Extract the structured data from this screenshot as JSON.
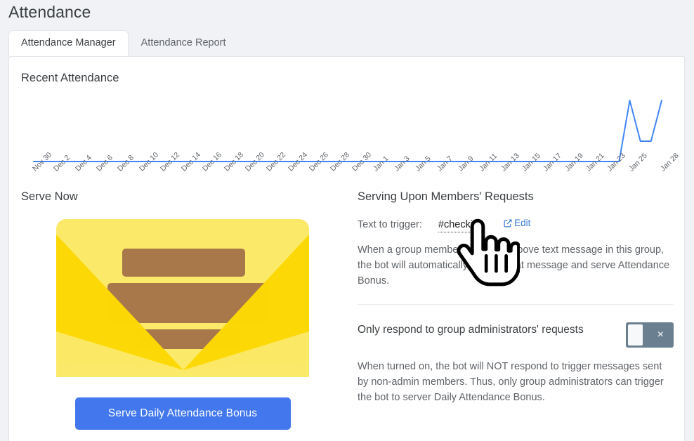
{
  "page": {
    "title": "Attendance",
    "background_color": "#f1f2f6",
    "card_color": "#ffffff"
  },
  "tabs": [
    {
      "label": "Attendance Manager",
      "active": true
    },
    {
      "label": "Attendance Report",
      "active": false
    }
  ],
  "chart_section": {
    "title": "Recent Attendance"
  },
  "chart_data": {
    "type": "line",
    "title": "Recent Attendance",
    "xlabel": "",
    "ylabel": "",
    "grid": false,
    "legend": "none",
    "line_color": "#4285f4",
    "ylim": [
      0,
      3
    ],
    "categories": [
      "Nov 30",
      "Dec 2",
      "Dec 4",
      "Dec 6",
      "Dec 8",
      "Dec 10",
      "Dec 12",
      "Dec 14",
      "Dec 16",
      "Dec 18",
      "Dec 20",
      "Dec 22",
      "Dec 24",
      "Dec 26",
      "Dec 28",
      "Dec 30",
      "Jan 1",
      "Jan 3",
      "Jan 5",
      "Jan 7",
      "Jan 9",
      "Jan 11",
      "Jan 13",
      "Jan 15",
      "Jan 17",
      "Jan 19",
      "Jan 21",
      "Jan 23",
      "Jan 25",
      "Jan 28"
    ],
    "x": [
      "Nov 30",
      "Dec 1",
      "Dec 2",
      "Dec 3",
      "Dec 4",
      "Dec 5",
      "Dec 6",
      "Dec 7",
      "Dec 8",
      "Dec 9",
      "Dec 10",
      "Dec 11",
      "Dec 12",
      "Dec 13",
      "Dec 14",
      "Dec 15",
      "Dec 16",
      "Dec 17",
      "Dec 18",
      "Dec 19",
      "Dec 20",
      "Dec 21",
      "Dec 22",
      "Dec 23",
      "Dec 24",
      "Dec 25",
      "Dec 26",
      "Dec 27",
      "Dec 28",
      "Dec 29",
      "Dec 30",
      "Dec 31",
      "Jan 1",
      "Jan 2",
      "Jan 3",
      "Jan 4",
      "Jan 5",
      "Jan 6",
      "Jan 7",
      "Jan 8",
      "Jan 9",
      "Jan 10",
      "Jan 11",
      "Jan 12",
      "Jan 13",
      "Jan 14",
      "Jan 15",
      "Jan 16",
      "Jan 17",
      "Jan 18",
      "Jan 19",
      "Jan 20",
      "Jan 21",
      "Jan 22",
      "Jan 23",
      "Jan 24",
      "Jan 25",
      "Jan 26",
      "Jan 27",
      "Jan 28"
    ],
    "values": [
      0,
      0,
      0,
      0,
      0,
      0,
      0,
      0,
      0,
      0,
      0,
      0,
      0,
      0,
      0,
      0,
      0,
      0,
      0,
      0,
      0,
      0,
      0,
      0,
      0,
      0,
      0,
      0,
      0,
      0,
      0,
      0,
      0,
      0,
      0,
      0,
      0,
      0,
      0,
      0,
      0,
      0,
      0,
      0,
      0,
      0,
      0,
      0,
      0,
      0,
      0,
      0,
      0,
      0,
      0,
      0,
      3,
      1,
      1,
      3
    ]
  },
  "serve_now": {
    "heading": "Serve Now",
    "illustration": "envelope-icon",
    "button_label": "Serve Daily Attendance Bonus",
    "button_color": "#4277ed"
  },
  "serving_requests": {
    "heading": "Serving Upon Members' Requests",
    "trigger_label": "Text to trigger:",
    "trigger_value": "#checkin",
    "edit_label": "Edit",
    "edit_icon": "external-link-edit-icon",
    "description": "When a group member sends the above text message in this group, the bot will automatically reply to that message and serve Attendance Bonus."
  },
  "admin_toggle": {
    "title": "Only respond to group administrators' requests",
    "state": "off",
    "mark": "×",
    "track_color": "#6a8090",
    "description": "When turned on, the bot will NOT respond to trigger messages sent by non-admin members. Thus, only group administrators can trigger the bot to server Daily Attendance Bonus."
  },
  "cursor": {
    "type": "pointing-hand-cursor"
  }
}
